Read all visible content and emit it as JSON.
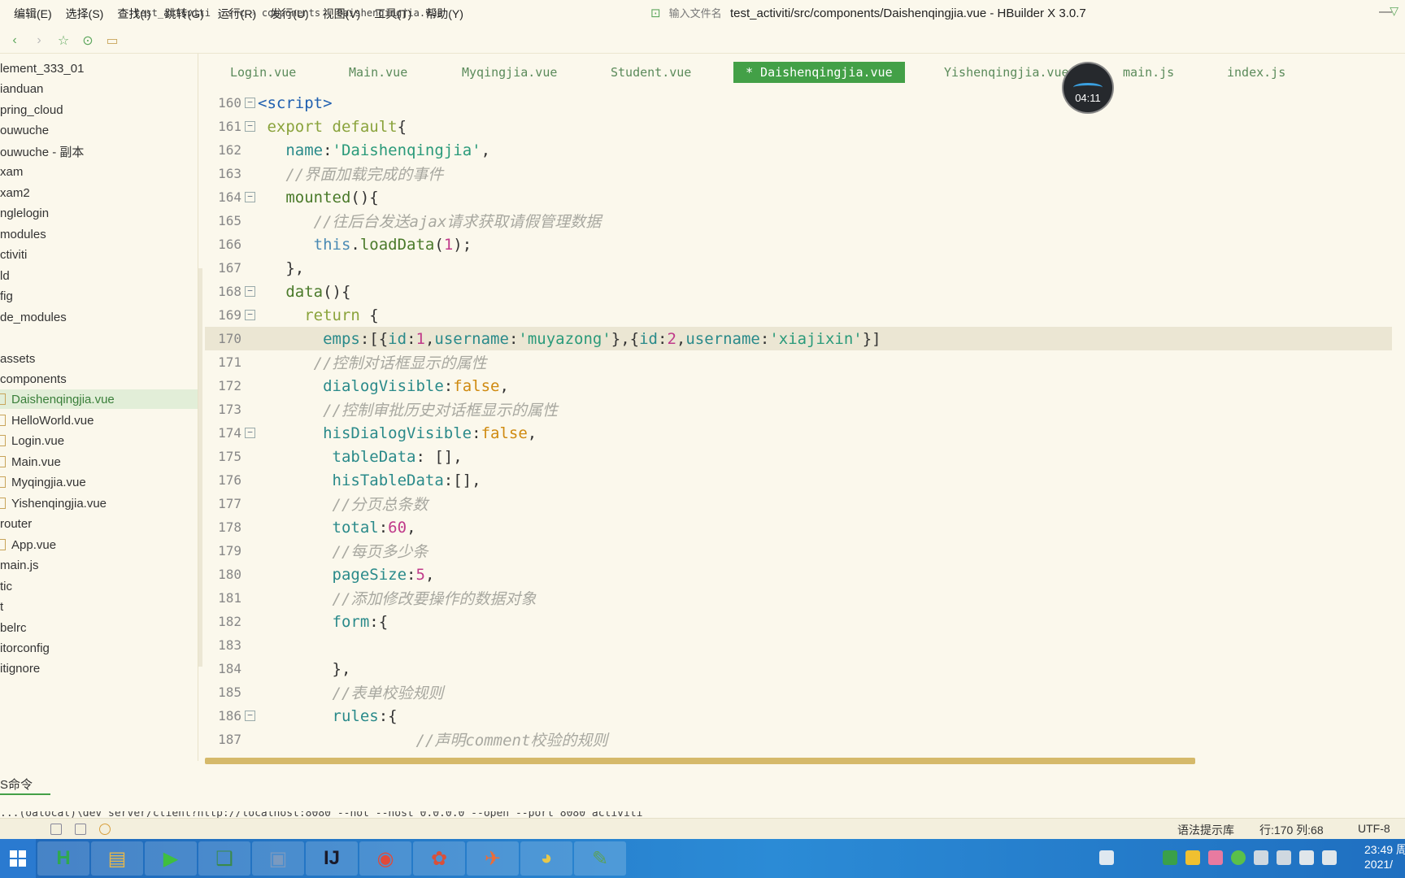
{
  "menu": [
    "编辑(E)",
    "选择(S)",
    "查找(I)",
    "跳转(G)",
    "运行(R)",
    "发行(U)",
    "视图(V)",
    "工具(T)",
    "帮助(Y)"
  ],
  "window_title": "test_activiti/src/components/Daishenqingjia.vue - HBuilder X 3.0.7",
  "breadcrumb": [
    "test_activiti",
    "src",
    "components",
    "Daishenqingjia.vue"
  ],
  "file_search_placeholder": "输入文件名",
  "sidebar": {
    "items": [
      {
        "label": "lement_333_01",
        "type": "folder"
      },
      {
        "label": "ianduan",
        "type": "folder"
      },
      {
        "label": "pring_cloud",
        "type": "folder"
      },
      {
        "label": "ouwuche",
        "type": "folder"
      },
      {
        "label": "ouwuche - 副本",
        "type": "folder"
      },
      {
        "label": "xam",
        "type": "folder"
      },
      {
        "label": "xam2",
        "type": "folder"
      },
      {
        "label": "nglelogin",
        "type": "folder"
      },
      {
        "label": "modules",
        "type": "folder"
      },
      {
        "label": "ctiviti",
        "type": "folder"
      },
      {
        "label": "ld",
        "type": "folder"
      },
      {
        "label": "fig",
        "type": "folder"
      },
      {
        "label": "de_modules",
        "type": "folder"
      },
      {
        "label": "",
        "type": "blank"
      },
      {
        "label": "assets",
        "type": "folder"
      },
      {
        "label": "components",
        "type": "folder"
      },
      {
        "label": "Daishenqingjia.vue",
        "type": "file",
        "active": true
      },
      {
        "label": "HelloWorld.vue",
        "type": "file"
      },
      {
        "label": "Login.vue",
        "type": "file"
      },
      {
        "label": "Main.vue",
        "type": "file"
      },
      {
        "label": "Myqingjia.vue",
        "type": "file"
      },
      {
        "label": "Yishenqingjia.vue",
        "type": "file"
      },
      {
        "label": "router",
        "type": "folder"
      },
      {
        "label": "App.vue",
        "type": "file"
      },
      {
        "label": "main.js",
        "type": "file"
      },
      {
        "label": "tic",
        "type": "folder"
      },
      {
        "label": "t",
        "type": "folder"
      },
      {
        "label": "belrc",
        "type": "file"
      },
      {
        "label": "itorconfig",
        "type": "file"
      },
      {
        "label": "itignore",
        "type": "file"
      }
    ]
  },
  "tabs": [
    {
      "label": "Login.vue"
    },
    {
      "label": "Main.vue"
    },
    {
      "label": "Myqingjia.vue"
    },
    {
      "label": "Student.vue"
    },
    {
      "label": "* Daishenqingjia.vue",
      "active": true
    },
    {
      "label": "Yishenqingjia.vue"
    },
    {
      "label": "main.js"
    },
    {
      "label": "index.js"
    }
  ],
  "timer": "04:11",
  "code": [
    {
      "n": "160",
      "fold": true,
      "tokens": [
        [
          "tag",
          "<script>"
        ]
      ]
    },
    {
      "n": "161",
      "fold": true,
      "tokens": [
        [
          "plain",
          " "
        ],
        [
          "kw",
          "export default"
        ],
        [
          "punc",
          "{"
        ]
      ]
    },
    {
      "n": "162",
      "fold": false,
      "tokens": [
        [
          "plain",
          "   "
        ],
        [
          "prop",
          "name"
        ],
        [
          "punc",
          ":"
        ],
        [
          "str",
          "'Daishenqingjia'"
        ],
        [
          "punc",
          ","
        ]
      ]
    },
    {
      "n": "163",
      "fold": false,
      "tokens": [
        [
          "plain",
          "   "
        ],
        [
          "cmt",
          "//界面加载完成的事件"
        ]
      ]
    },
    {
      "n": "164",
      "fold": true,
      "tokens": [
        [
          "plain",
          "   "
        ],
        [
          "fn",
          "mounted"
        ],
        [
          "punc",
          "(){"
        ]
      ]
    },
    {
      "n": "165",
      "fold": false,
      "tokens": [
        [
          "plain",
          "      "
        ],
        [
          "cmt",
          "//往后台发送ajax请求获取请假管理数据"
        ]
      ]
    },
    {
      "n": "166",
      "fold": false,
      "tokens": [
        [
          "plain",
          "      "
        ],
        [
          "this",
          "this"
        ],
        [
          "punc",
          "."
        ],
        [
          "fn",
          "loadData"
        ],
        [
          "punc",
          "("
        ],
        [
          "num",
          "1"
        ],
        [
          "punc",
          ");"
        ]
      ]
    },
    {
      "n": "167",
      "fold": false,
      "tokens": [
        [
          "plain",
          "   "
        ],
        [
          "punc",
          "},"
        ]
      ]
    },
    {
      "n": "168",
      "fold": true,
      "tokens": [
        [
          "plain",
          "   "
        ],
        [
          "fn",
          "data"
        ],
        [
          "punc",
          "(){"
        ]
      ]
    },
    {
      "n": "169",
      "fold": true,
      "tokens": [
        [
          "plain",
          "     "
        ],
        [
          "kw",
          "return"
        ],
        [
          "punc",
          " {"
        ]
      ]
    },
    {
      "n": "170",
      "fold": false,
      "current": true,
      "tokens": [
        [
          "plain",
          "       "
        ],
        [
          "prop",
          "emps"
        ],
        [
          "punc",
          ":[{"
        ],
        [
          "prop",
          "id"
        ],
        [
          "punc",
          ":"
        ],
        [
          "num",
          "1"
        ],
        [
          "punc",
          ","
        ],
        [
          "prop",
          "username"
        ],
        [
          "punc",
          ":"
        ],
        [
          "str",
          "'muyazong'"
        ],
        [
          "punc",
          "},{"
        ],
        [
          "prop",
          "id"
        ],
        [
          "punc",
          ":"
        ],
        [
          "num",
          "2"
        ],
        [
          "punc",
          ","
        ],
        [
          "prop",
          "username"
        ],
        [
          "punc",
          ":"
        ],
        [
          "str",
          "'xiajixin'"
        ],
        [
          "punc",
          "}]"
        ]
      ]
    },
    {
      "n": "171",
      "fold": false,
      "tokens": [
        [
          "plain",
          "      "
        ],
        [
          "cmt",
          "//控制对话框显示的属性"
        ]
      ]
    },
    {
      "n": "172",
      "fold": false,
      "tokens": [
        [
          "plain",
          "       "
        ],
        [
          "prop",
          "dialogVisible"
        ],
        [
          "punc",
          ":"
        ],
        [
          "bool",
          "false"
        ],
        [
          "punc",
          ","
        ]
      ]
    },
    {
      "n": "173",
      "fold": false,
      "tokens": [
        [
          "plain",
          "       "
        ],
        [
          "cmt",
          "//控制审批历史对话框显示的属性"
        ]
      ]
    },
    {
      "n": "174",
      "fold": true,
      "tokens": [
        [
          "plain",
          "       "
        ],
        [
          "prop",
          "hisDialogVisible"
        ],
        [
          "punc",
          ":"
        ],
        [
          "bool",
          "false"
        ],
        [
          "punc",
          ","
        ]
      ]
    },
    {
      "n": "175",
      "fold": false,
      "tokens": [
        [
          "plain",
          "        "
        ],
        [
          "prop",
          "tableData"
        ],
        [
          "punc",
          ": [],"
        ]
      ]
    },
    {
      "n": "176",
      "fold": false,
      "tokens": [
        [
          "plain",
          "        "
        ],
        [
          "prop",
          "hisTableData"
        ],
        [
          "punc",
          ":[],"
        ]
      ]
    },
    {
      "n": "177",
      "fold": false,
      "tokens": [
        [
          "plain",
          "        "
        ],
        [
          "cmt",
          "//分页总条数"
        ]
      ]
    },
    {
      "n": "178",
      "fold": false,
      "tokens": [
        [
          "plain",
          "        "
        ],
        [
          "prop",
          "total"
        ],
        [
          "punc",
          ":"
        ],
        [
          "num",
          "60"
        ],
        [
          "punc",
          ","
        ]
      ]
    },
    {
      "n": "179",
      "fold": false,
      "tokens": [
        [
          "plain",
          "        "
        ],
        [
          "cmt",
          "//每页多少条"
        ]
      ]
    },
    {
      "n": "180",
      "fold": false,
      "tokens": [
        [
          "plain",
          "        "
        ],
        [
          "prop",
          "pageSize"
        ],
        [
          "punc",
          ":"
        ],
        [
          "num",
          "5"
        ],
        [
          "punc",
          ","
        ]
      ]
    },
    {
      "n": "181",
      "fold": false,
      "tokens": [
        [
          "plain",
          "        "
        ],
        [
          "cmt",
          "//添加修改要操作的数据对象"
        ]
      ]
    },
    {
      "n": "182",
      "fold": false,
      "tokens": [
        [
          "plain",
          "        "
        ],
        [
          "prop",
          "form"
        ],
        [
          "punc",
          ":{"
        ]
      ]
    },
    {
      "n": "183",
      "fold": false,
      "tokens": [
        [
          "plain",
          ""
        ]
      ]
    },
    {
      "n": "184",
      "fold": false,
      "tokens": [
        [
          "plain",
          "        "
        ],
        [
          "punc",
          "},"
        ]
      ]
    },
    {
      "n": "185",
      "fold": false,
      "tokens": [
        [
          "plain",
          "        "
        ],
        [
          "cmt",
          "//表单校验规则"
        ]
      ]
    },
    {
      "n": "186",
      "fold": true,
      "tokens": [
        [
          "plain",
          "        "
        ],
        [
          "prop",
          "rules"
        ],
        [
          "punc",
          ":{"
        ]
      ]
    },
    {
      "n": "187",
      "fold": false,
      "tokens": [
        [
          "plain",
          "                 "
        ],
        [
          "cmt",
          "//声明comment校验的规则"
        ]
      ]
    }
  ],
  "console_tab": "S命令",
  "console_line": "...(oalocal)\\dev_server/client?http://localhost:8080 --hot --host 0.0.0.0 --open --port 8080 activiti",
  "status": {
    "syntax": "语法提示库",
    "position": "行:170  列:68",
    "encoding": "UTF-8"
  },
  "taskbar": {
    "apps": [
      {
        "name": "hbuilder-icon",
        "glyph": "H",
        "color": "#2fa84f"
      },
      {
        "name": "file-explorer-icon",
        "glyph": "▤",
        "color": "#e8b84a"
      },
      {
        "name": "media-player-icon",
        "glyph": "▶",
        "color": "#3fbf3f"
      },
      {
        "name": "archive-icon",
        "glyph": "❑",
        "color": "#3a8a4a"
      },
      {
        "name": "remote-desktop-icon",
        "glyph": "▣",
        "color": "#7a9ac0"
      },
      {
        "name": "intellij-icon",
        "glyph": "IJ",
        "color": "#1a1a2a"
      },
      {
        "name": "chrome-icon",
        "glyph": "◉",
        "color": "#e04a3a"
      },
      {
        "name": "paint-icon",
        "glyph": "✿",
        "color": "#d9503a"
      },
      {
        "name": "postman-icon",
        "glyph": "✈",
        "color": "#ef6c35"
      },
      {
        "name": "chat-icon",
        "glyph": "◕",
        "color": "#e8c84a"
      },
      {
        "name": "notepad-icon",
        "glyph": "✎",
        "color": "#5aa05a"
      }
    ],
    "clock_time": "23:49 周",
    "clock_date": "2021/"
  },
  "colors": {
    "background": "#fbf8ec",
    "accent": "#43a047",
    "current_line": "#ebe6d3",
    "taskbar": "#2b8bd6"
  }
}
